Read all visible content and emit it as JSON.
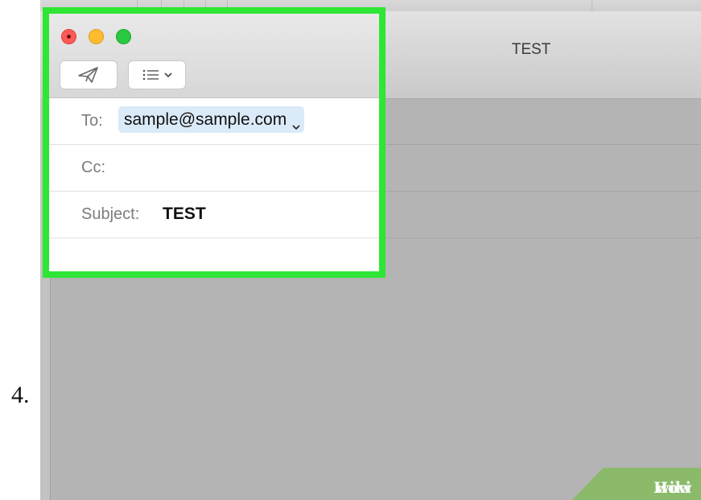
{
  "step": {
    "number": "4."
  },
  "background_window": {
    "title": "TEST"
  },
  "compose": {
    "toolbar": {
      "send_icon": "paper-plane-icon",
      "format_icon": "list-format-icon",
      "chevron_icon": "chevron-down-icon"
    },
    "fields": {
      "to_label": "To:",
      "to_value": "sample@sample.com",
      "cc_label": "Cc:",
      "cc_value": "",
      "subject_label": "Subject:",
      "subject_value": "TEST"
    }
  },
  "watermark": {
    "wiki": "wiki",
    "how": "How"
  },
  "colors": {
    "highlight": "#2fe535",
    "recipient_token": "#dbeaf8",
    "close": "#fc5b57",
    "minimize": "#fdbc2e",
    "maximize": "#28c840",
    "watermark": "#8aba6a"
  }
}
